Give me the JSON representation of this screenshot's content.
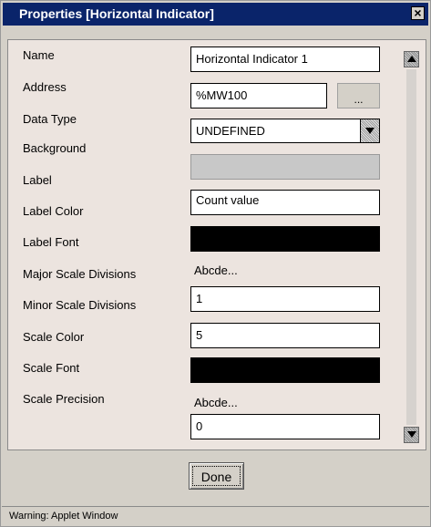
{
  "window": {
    "title": "Properties [Horizontal Indicator]",
    "close_glyph": "×",
    "close_icon": "close-icon"
  },
  "properties": {
    "name": {
      "label": "Name",
      "value": "Horizontal Indicator 1"
    },
    "address": {
      "label": "Address",
      "value": "%MW100",
      "browse_label": "..."
    },
    "data_type": {
      "label": "Data Type",
      "value": "UNDEFINED",
      "icon": "chevron-down-icon"
    },
    "background": {
      "label": "Background",
      "color": "#c8c8c8"
    },
    "label": {
      "label": "Label",
      "value": "Count value"
    },
    "label_color": {
      "label": "Label Color",
      "color": "#000000"
    },
    "label_font": {
      "label": "Label Font",
      "value": "Abcde..."
    },
    "major_scale_divisions": {
      "label": "Major Scale Divisions",
      "value": "1"
    },
    "minor_scale_divisions": {
      "label": "Minor Scale Divisions",
      "value": "5"
    },
    "scale_color": {
      "label": "Scale Color",
      "color": "#000000"
    },
    "scale_font": {
      "label": "Scale Font",
      "value": "Abcde..."
    },
    "scale_precision": {
      "label": "Scale Precision",
      "value": "0"
    }
  },
  "scrollbar": {
    "up_icon": "arrow-up-icon",
    "down_icon": "arrow-down-icon"
  },
  "footer": {
    "done_label": "Done"
  },
  "status": {
    "text": "Warning: Applet Window"
  }
}
